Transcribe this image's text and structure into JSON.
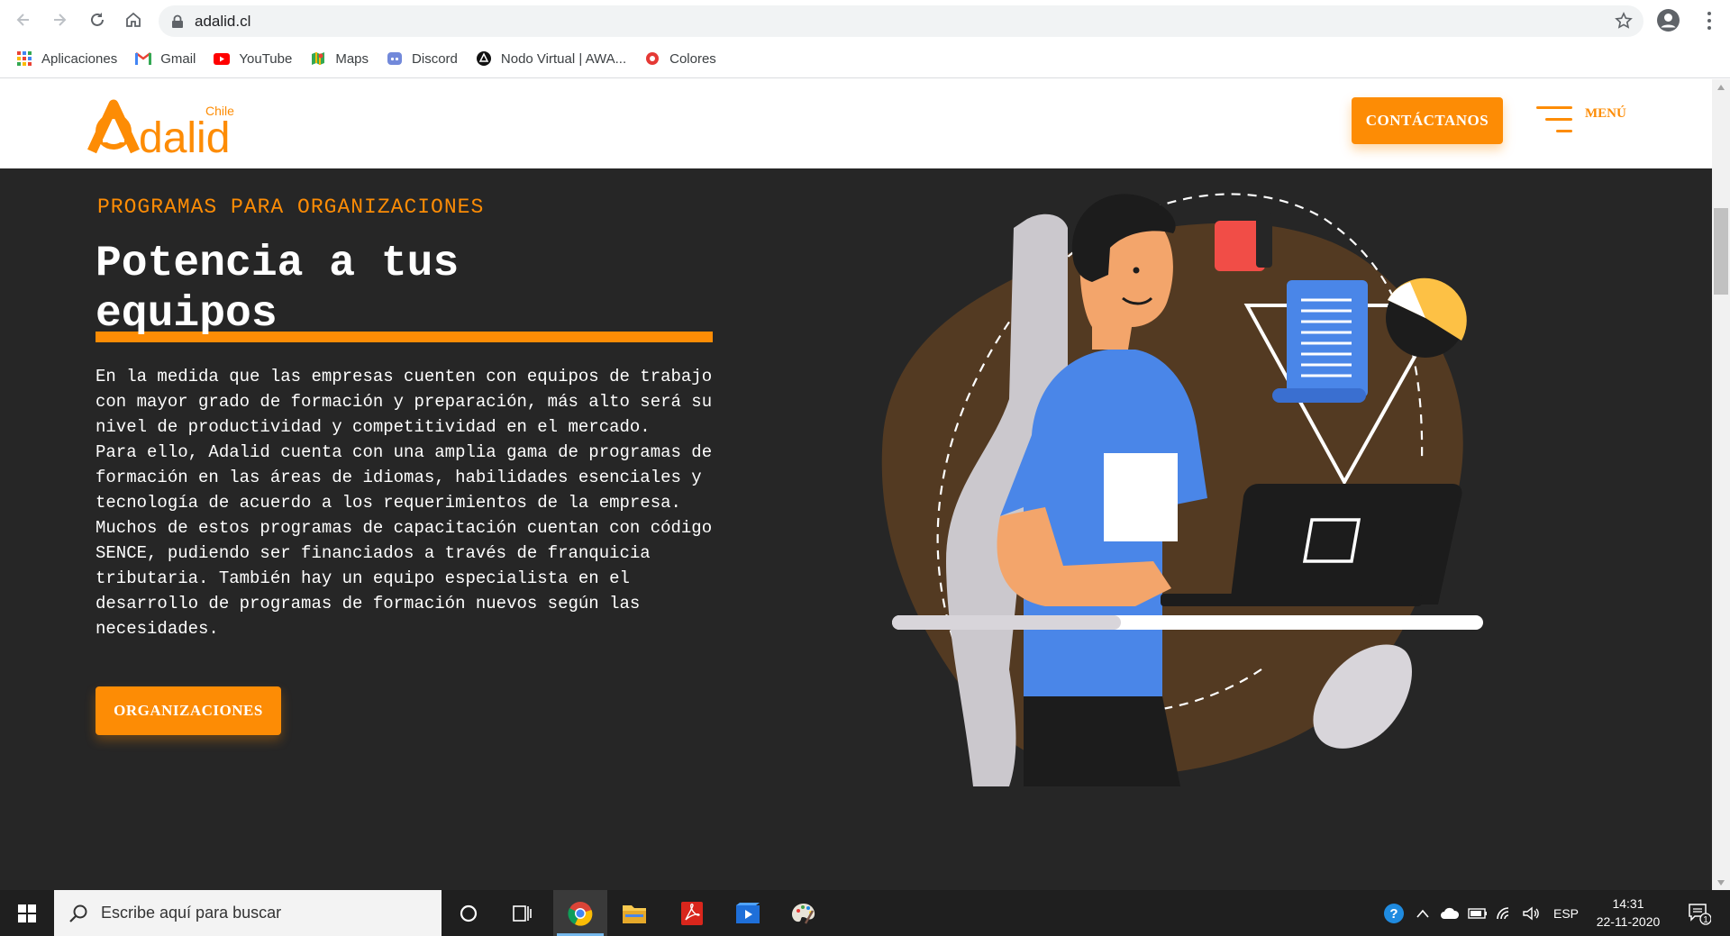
{
  "browser": {
    "url": "adalid.cl",
    "bookmarks": [
      {
        "label": "Aplicaciones",
        "icon": "apps-grid-icon"
      },
      {
        "label": "Gmail",
        "icon": "gmail-icon"
      },
      {
        "label": "YouTube",
        "icon": "youtube-icon"
      },
      {
        "label": "Maps",
        "icon": "maps-icon"
      },
      {
        "label": "Discord",
        "icon": "discord-icon"
      },
      {
        "label": "Nodo Virtual | AWA...",
        "icon": "nodo-virtual-icon"
      },
      {
        "label": "Colores",
        "icon": "colores-icon"
      }
    ]
  },
  "site": {
    "logo_text": "Adalid",
    "logo_sub": "Chile",
    "contact_label": "CONTÁCTANOS",
    "menu_label": "MENÚ",
    "accent_color": "#fd8c05",
    "hero_bg": "#262626"
  },
  "hero": {
    "eyebrow": "PROGRAMAS PARA ORGANIZACIONES",
    "headline": "Potencia a tus equipos",
    "paragraphs": [
      "En la medida que las empresas cuenten con equipos de trabajo con mayor grado de formación y preparación, más alto será su nivel de productividad y competitividad en el mercado.",
      "Para ello, Adalid cuenta con una amplia gama de programas de formación en las áreas de idiomas, habilidades esenciales y tecnología de acuerdo a los requerimientos de la empresa.",
      "Muchos de estos programas de capacitación cuentan con código SENCE, pudiendo ser financiados a través de franquicia tributaria. También hay un equipo especialista en el desarrollo de programas de formación nuevos según las necesidades."
    ],
    "cta_label": "ORGANIZACIONES"
  },
  "taskbar": {
    "search_placeholder": "Escribe aquí para buscar",
    "language": "ESP",
    "time": "14:31",
    "date": "22-11-2020",
    "notification_count": "1"
  }
}
